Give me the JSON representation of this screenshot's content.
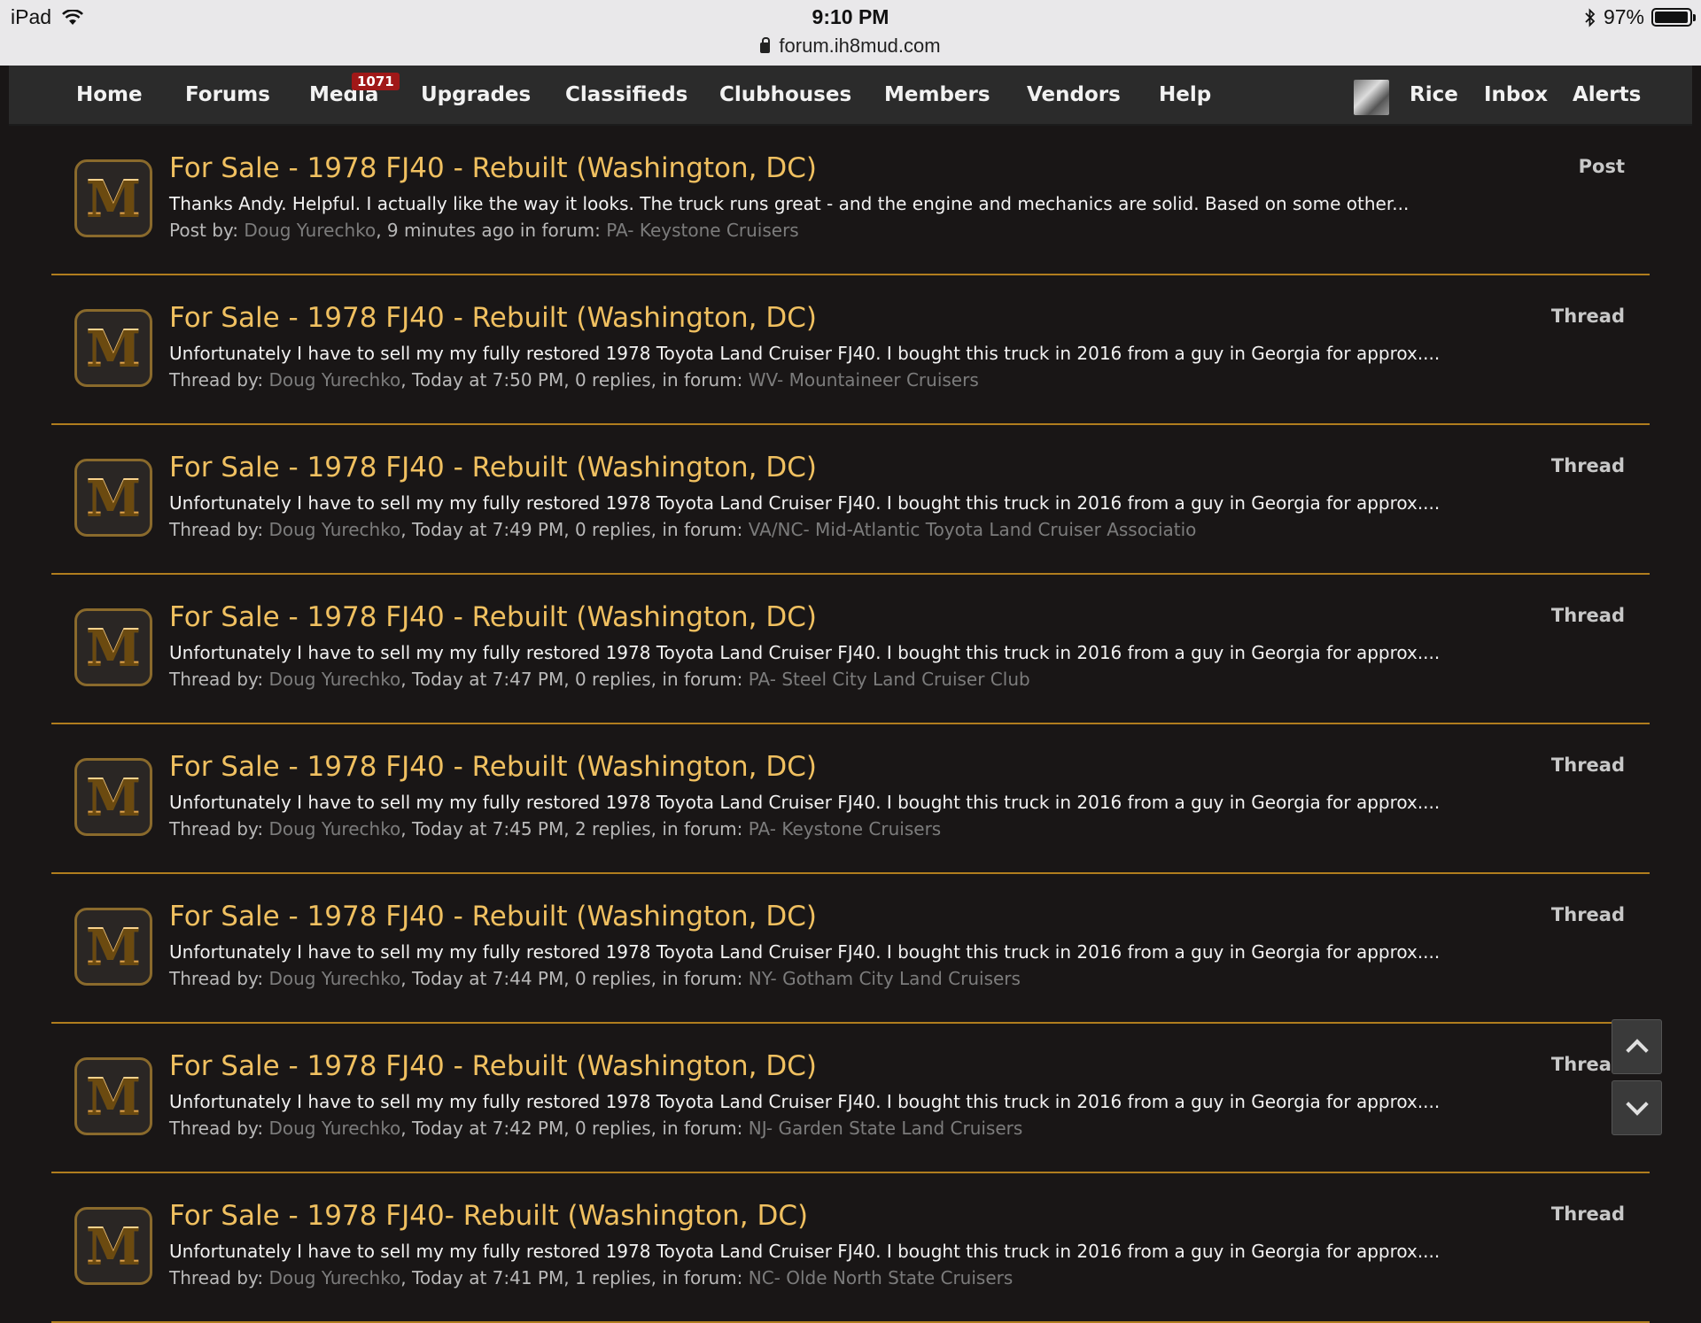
{
  "status_bar": {
    "device": "iPad",
    "time": "9:10 PM",
    "url": "forum.ih8mud.com",
    "battery": "97%",
    "battery_level": 0.97
  },
  "nav": {
    "items": [
      {
        "label": "Home"
      },
      {
        "label": "Forums"
      },
      {
        "label": "Media",
        "badge": "1071"
      },
      {
        "label": "Upgrades"
      },
      {
        "label": "Classifieds"
      },
      {
        "label": "Clubhouses"
      },
      {
        "label": "Members"
      },
      {
        "label": "Vendors"
      },
      {
        "label": "Help"
      }
    ],
    "user": {
      "name": "Rice"
    },
    "inbox_label": "Inbox",
    "alerts_label": "Alerts"
  },
  "colors": {
    "accent": "#f0c060",
    "divider": "#b07d1e",
    "badge": "#a01818"
  },
  "results": [
    {
      "type": "Post",
      "title": "For Sale - 1978 FJ40 - Rebuilt (Washington, DC)",
      "snippet": "Thanks Andy. Helpful. I actually like the way it looks. The truck runs great - and the engine and mechanics are solid. Based on some other...",
      "by_label": "Post by:",
      "author": "Doug Yurechko",
      "details": ", 9 minutes ago in forum:",
      "forum": "PA- Keystone Cruisers"
    },
    {
      "type": "Thread",
      "title": "For Sale - 1978 FJ40 - Rebuilt (Washington, DC)",
      "snippet": "Unfortunately I have to sell my my fully restored 1978 Toyota Land Cruiser FJ40. I bought this truck in 2016 from a guy in Georgia for approx....",
      "by_label": "Thread by:",
      "author": "Doug Yurechko",
      "details": ", Today at 7:50 PM, 0 replies, in forum:",
      "forum": "WV- Mountaineer Cruisers"
    },
    {
      "type": "Thread",
      "title": "For Sale - 1978 FJ40 - Rebuilt (Washington, DC)",
      "snippet": "Unfortunately I have to sell my my fully restored 1978 Toyota Land Cruiser FJ40. I bought this truck in 2016 from a guy in Georgia for approx....",
      "by_label": "Thread by:",
      "author": "Doug Yurechko",
      "details": ", Today at 7:49 PM, 0 replies, in forum:",
      "forum": "VA/NC- Mid-Atlantic Toyota Land Cruiser Associatio"
    },
    {
      "type": "Thread",
      "title": "For Sale - 1978 FJ40 - Rebuilt (Washington, DC)",
      "snippet": "Unfortunately I have to sell my my fully restored 1978 Toyota Land Cruiser FJ40. I bought this truck in 2016 from a guy in Georgia for approx....",
      "by_label": "Thread by:",
      "author": "Doug Yurechko",
      "details": ", Today at 7:47 PM, 0 replies, in forum:",
      "forum": "PA- Steel City Land Cruiser Club"
    },
    {
      "type": "Thread",
      "title": "For Sale - 1978 FJ40 - Rebuilt (Washington, DC)",
      "snippet": "Unfortunately I have to sell my my fully restored 1978 Toyota Land Cruiser FJ40. I bought this truck in 2016 from a guy in Georgia for approx....",
      "by_label": "Thread by:",
      "author": "Doug Yurechko",
      "details": ", Today at 7:45 PM, 2 replies, in forum:",
      "forum": "PA- Keystone Cruisers"
    },
    {
      "type": "Thread",
      "title": "For Sale - 1978 FJ40 - Rebuilt (Washington, DC)",
      "snippet": "Unfortunately I have to sell my my fully restored 1978 Toyota Land Cruiser FJ40. I bought this truck in 2016 from a guy in Georgia for approx....",
      "by_label": "Thread by:",
      "author": "Doug Yurechko",
      "details": ", Today at 7:44 PM, 0 replies, in forum:",
      "forum": "NY- Gotham City Land Cruisers"
    },
    {
      "type": "Thread",
      "title": "For Sale - 1978 FJ40 - Rebuilt (Washington, DC)",
      "snippet": "Unfortunately I have to sell my my fully restored 1978 Toyota Land Cruiser FJ40. I bought this truck in 2016 from a guy in Georgia for approx....",
      "by_label": "Thread by:",
      "author": "Doug Yurechko",
      "details": ", Today at 7:42 PM, 0 replies, in forum:",
      "forum": "NJ- Garden State Land Cruisers"
    },
    {
      "type": "Thread",
      "title": "For Sale - 1978 FJ40- Rebuilt (Washington, DC)",
      "snippet": "Unfortunately I have to sell my my fully restored 1978 Toyota Land Cruiser FJ40. I bought this truck in 2016 from a guy in Georgia for approx....",
      "by_label": "Thread by:",
      "author": "Doug Yurechko",
      "details": ", Today at 7:41 PM, 1 replies, in forum:",
      "forum": "NC- Olde North State Cruisers"
    }
  ],
  "icons": {
    "result_icon": "ih8mud-m-logo-icon",
    "wifi": "wifi-icon",
    "bluetooth": "bluetooth-icon",
    "scroll_up": "chevron-up-icon",
    "scroll_down": "chevron-down-icon"
  }
}
